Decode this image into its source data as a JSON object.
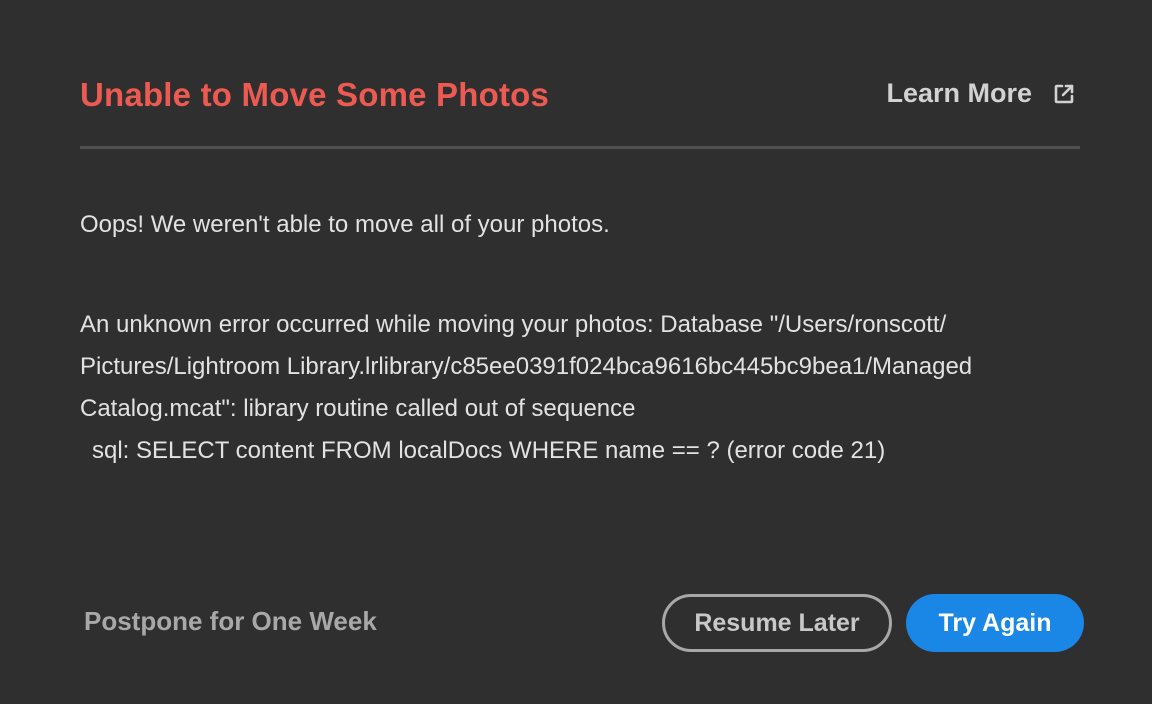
{
  "dialog": {
    "title": "Unable to Move Some Photos",
    "learn_more_label": "Learn More",
    "learn_more_icon": "external-link-icon",
    "intro": "Oops! We weren't able to move all of your photos.",
    "detail_lines": [
      "An unknown error occurred while moving your photos: Database \"/Users/ronscott/",
      "Pictures/Lightroom Library.lrlibrary/c85ee0391f024bca9616bc445bc9bea1/Managed",
      "Catalog.mcat\": library routine called out of sequence",
      "sql: SELECT content FROM localDocs WHERE name == ? (error code 21)"
    ]
  },
  "footer": {
    "postpone_label": "Postpone for One Week",
    "resume_label": "Resume Later",
    "try_again_label": "Try Again"
  },
  "colors": {
    "background": "#2f2f2f",
    "title": "#ec5a52",
    "primary_button": "#1a86e6",
    "divider": "#4f4f4f"
  }
}
